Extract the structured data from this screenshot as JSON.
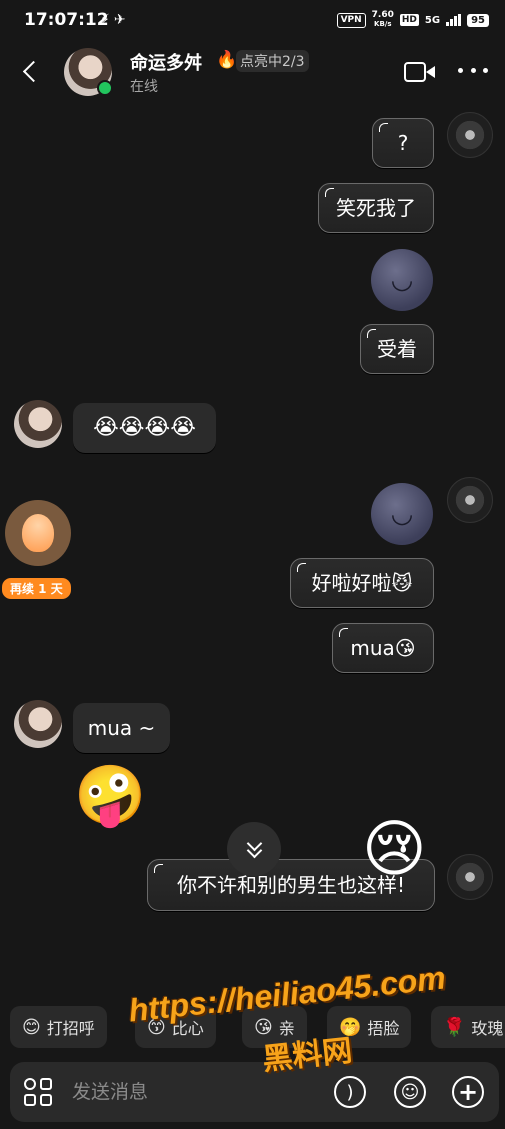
{
  "status_bar": {
    "time": "17:07:12",
    "left_icons": "⚡✈",
    "vpn": "VPN",
    "net_speed_value": "7.60",
    "net_speed_unit": "KB/s",
    "hd": "HD",
    "network": "5G",
    "battery": "95"
  },
  "header": {
    "contact_name": "命运多舛",
    "streak_icon": "🔥",
    "streak_progress": "点亮中2/3",
    "presence": "在线",
    "icons": [
      "back-icon",
      "video-call-icon",
      "more-icon"
    ]
  },
  "messages": [
    {
      "side": "me",
      "text": "?"
    },
    {
      "side": "me",
      "text": "笑死我了"
    },
    {
      "side": "me",
      "emoji": "🌚"
    },
    {
      "side": "me",
      "text": "受着"
    },
    {
      "side": "them",
      "text": "😭😭😭😭"
    },
    {
      "side": "me",
      "emoji": "🌚"
    },
    {
      "side": "me",
      "text": "好啦好啦😼"
    },
    {
      "side": "me",
      "text": "mua😘"
    },
    {
      "side": "them",
      "text": "mua ~"
    },
    {
      "side": "them",
      "emoji": "🤪"
    },
    {
      "side": "me",
      "text": "你不许和别的男生也这样!"
    }
  ],
  "streak_pet": {
    "label": "再续 1 天"
  },
  "floating_emoji": "😢",
  "quick_replies": [
    {
      "emoji": "😊",
      "label": "打招呼"
    },
    {
      "emoji": "😙",
      "label": "比心"
    },
    {
      "emoji": "😘",
      "label": "亲"
    },
    {
      "emoji": "🤭",
      "label": "捂脸"
    },
    {
      "emoji": "🌹",
      "label": "玫瑰"
    }
  ],
  "input": {
    "placeholder": "发送消息"
  },
  "watermark": {
    "url": "https://heiliao45.com",
    "name": "黑料网"
  }
}
